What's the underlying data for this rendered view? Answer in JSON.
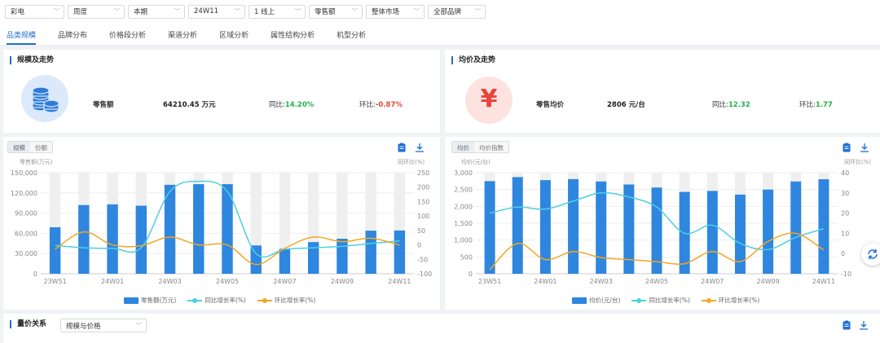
{
  "filters": [
    {
      "value": "彩电"
    },
    {
      "value": "周度"
    },
    {
      "value": "本期"
    },
    {
      "value": "24W11"
    },
    {
      "value": "1 线上"
    },
    {
      "value": "零售额"
    },
    {
      "value": "整体市场"
    },
    {
      "value": "全部品牌"
    }
  ],
  "tabs": [
    "品类规模",
    "品牌分布",
    "价格段分析",
    "渠道分析",
    "区域分析",
    "属性结构分析",
    "机型分析"
  ],
  "scale_panel": {
    "title": "规模及走势",
    "kpi_label": "零售额",
    "kpi_value": "64210.45 万元",
    "yoy_label": "同比:",
    "yoy_value": "14.20%",
    "mom_label": "环比:",
    "mom_value": "-0.87%"
  },
  "price_panel": {
    "title": "均价及走势",
    "icon_glyph": "¥",
    "kpi_label": "零售均价",
    "kpi_value": "2806 元/台",
    "yoy_label": "同比:",
    "yoy_value": "12.32",
    "mom_label": "环比:",
    "mom_value": "1.77"
  },
  "left_chart_toggle": [
    "规模",
    "份额"
  ],
  "right_chart_toggle": [
    "均价",
    "均价指数"
  ],
  "colors": {
    "accent": "#1f6fd4",
    "bar": "#2e86de",
    "yoy": "#4fcfe0",
    "mom": "#f5a623",
    "up": "#27b14b",
    "down": "#e04a36"
  },
  "bottom": {
    "title": "量价关系",
    "select_value": "规模与价格"
  },
  "chart_data": [
    {
      "type": "bar",
      "y_axis_label": "零售额(万元)",
      "y2_axis_label": "同环比(%)",
      "ylim": [
        0,
        150000
      ],
      "y_ticks": [
        "0",
        "30,000",
        "60,000",
        "90,000",
        "120,000",
        "150,000"
      ],
      "y2lim": [
        -100,
        250
      ],
      "y2_ticks": [
        "-100",
        "-50",
        "0",
        "50",
        "100",
        "150",
        "200",
        "250"
      ],
      "categories": [
        "23W51",
        "23W52",
        "24W01",
        "24W02",
        "24W03",
        "24W04",
        "24W05",
        "24W06",
        "24W07",
        "24W08",
        "24W09",
        "24W10",
        "24W11"
      ],
      "x_tick_labels": [
        "23W51",
        "24W01",
        "24W03",
        "24W05",
        "24W07",
        "24W09",
        "24W11"
      ],
      "series": [
        {
          "name": "零售额(万元)",
          "kind": "bar",
          "values": [
            69000,
            102000,
            103000,
            101000,
            132000,
            133000,
            133000,
            42000,
            37000,
            47000,
            52000,
            64000,
            64210
          ]
        },
        {
          "name": "同比增长率(%)",
          "kind": "line",
          "axis": "right",
          "values": [
            -2,
            -10,
            -12,
            -10,
            185,
            220,
            185,
            -30,
            -15,
            -10,
            -5,
            5,
            14
          ]
        },
        {
          "name": "环比增长率(%)",
          "kind": "line",
          "axis": "right",
          "values": [
            -15,
            45,
            0,
            -3,
            27,
            0,
            0,
            -68,
            -12,
            27,
            11,
            23,
            -1
          ]
        }
      ],
      "grid": true,
      "legend": "bottom"
    },
    {
      "type": "bar",
      "y_axis_label": "均价(元/台)",
      "y2_axis_label": "同环比(%)",
      "ylim": [
        0,
        3000
      ],
      "y_ticks": [
        "0",
        "500",
        "1,000",
        "1,500",
        "2,000",
        "2,500",
        "3,000"
      ],
      "y2lim": [
        -10,
        40
      ],
      "y2_ticks": [
        "-10",
        "0",
        "10",
        "20",
        "30",
        "40"
      ],
      "categories": [
        "23W51",
        "23W52",
        "24W01",
        "24W02",
        "24W03",
        "24W04",
        "24W05",
        "24W06",
        "24W07",
        "24W08",
        "24W09",
        "24W10",
        "24W11"
      ],
      "x_tick_labels": [
        "23W51",
        "24W01",
        "24W03",
        "24W05",
        "24W07",
        "24W09",
        "24W11"
      ],
      "series": [
        {
          "name": "均价(元/台)",
          "kind": "bar",
          "values": [
            2750,
            2870,
            2780,
            2810,
            2740,
            2650,
            2560,
            2430,
            2460,
            2350,
            2500,
            2740,
            2806
          ]
        },
        {
          "name": "同比增长率(%)",
          "kind": "line",
          "axis": "right",
          "values": [
            20,
            23,
            22,
            26,
            30,
            28,
            23,
            10,
            14,
            5,
            2,
            8,
            12.32
          ]
        },
        {
          "name": "环比增长率(%)",
          "kind": "line",
          "axis": "right",
          "values": [
            -8,
            5,
            -3,
            1,
            -2,
            -3,
            -4,
            -5,
            1,
            -4,
            6,
            10,
            1.77
          ]
        }
      ],
      "grid": true,
      "legend": "bottom"
    }
  ]
}
